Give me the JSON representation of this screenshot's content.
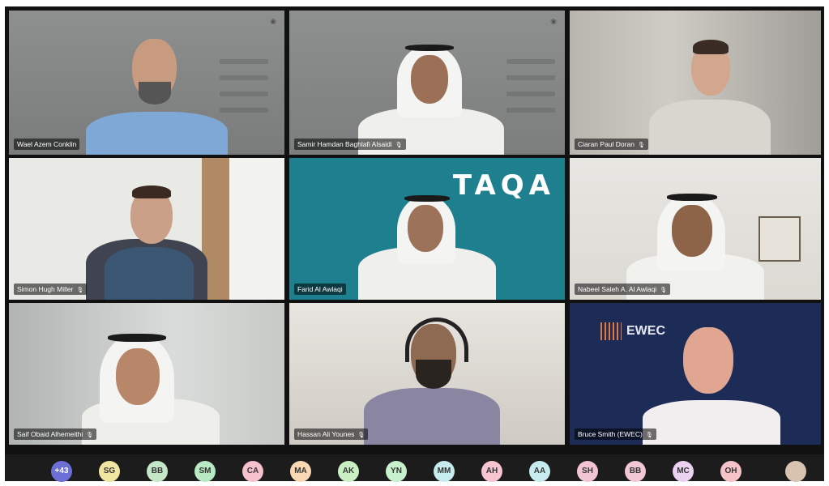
{
  "participants": [
    {
      "name": "Wael Azem Conklin"
    },
    {
      "name": "Samir Hamdan Baghlafi Alsaidi"
    },
    {
      "name": "Ciaran Paul Doran"
    },
    {
      "name": "Simon Hugh Miller"
    },
    {
      "name": "Farid Al Awlaqi"
    },
    {
      "name": "Nabeel Saleh A. Al Awlaqi"
    },
    {
      "name": "Saif Obaid Alhemeithi"
    },
    {
      "name": "Hassan Ali Younes"
    },
    {
      "name": "Bruce Smith (EWEC)"
    }
  ],
  "taqa_logo": "TAQA",
  "ewec_logo": "EWEC",
  "avatars": [
    {
      "initials": "+43",
      "color": "#6b6fd6"
    },
    {
      "initials": "SG",
      "color": "#f0e6a2"
    },
    {
      "initials": "BB",
      "color": "#c4e8c7"
    },
    {
      "initials": "SM",
      "color": "#b7e9c2"
    },
    {
      "initials": "CA",
      "color": "#f4c1cc"
    },
    {
      "initials": "MA",
      "color": "#f8d9b4"
    },
    {
      "initials": "AK",
      "color": "#c9efc2"
    },
    {
      "initials": "YN",
      "color": "#c7f1cc"
    },
    {
      "initials": "MM",
      "color": "#c7ecf0"
    },
    {
      "initials": "AH",
      "color": "#f6c5cf"
    },
    {
      "initials": "AA",
      "color": "#c7ecef"
    },
    {
      "initials": "SH",
      "color": "#f3c5d4"
    },
    {
      "initials": "BB",
      "color": "#f1c6d6"
    },
    {
      "initials": "MC",
      "color": "#ead2f0"
    },
    {
      "initials": "OH",
      "color": "#f5c3c8"
    }
  ]
}
